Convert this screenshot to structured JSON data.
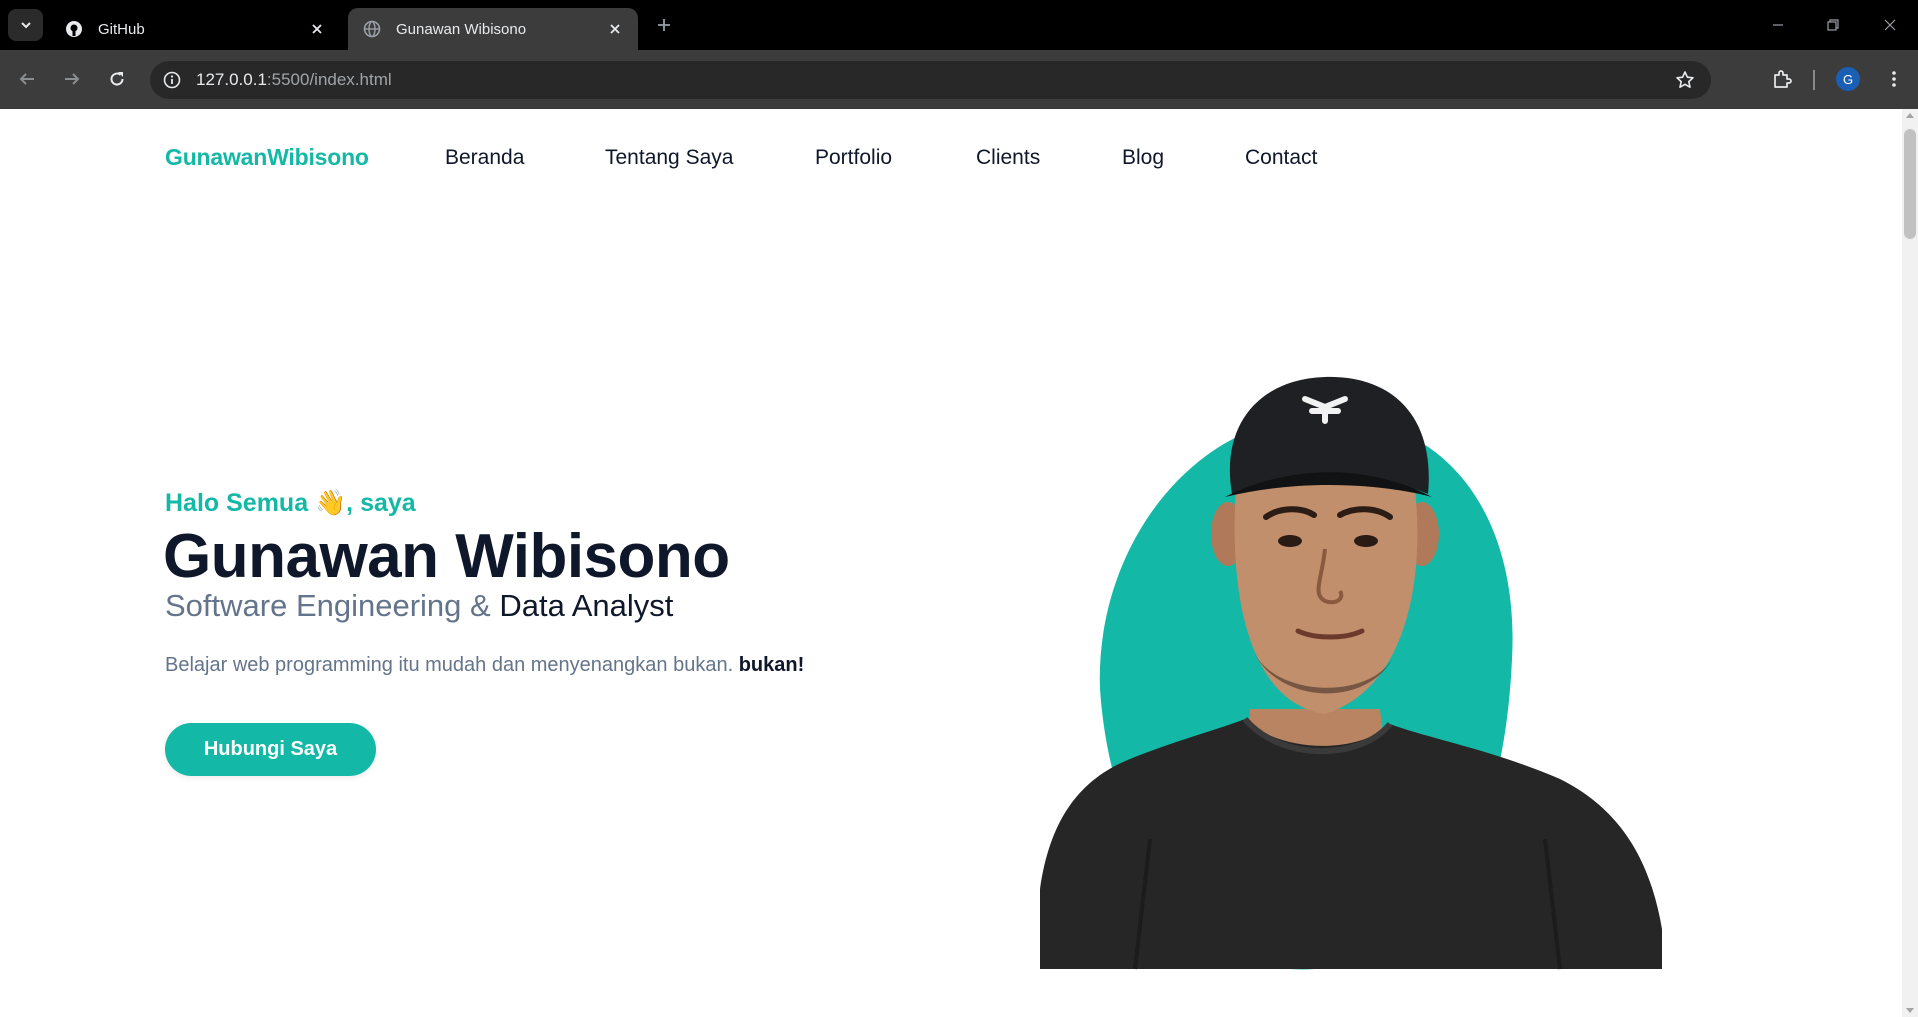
{
  "browser": {
    "tabs": [
      {
        "title": "GitHub",
        "icon": "github-icon",
        "active": false
      },
      {
        "title": "Gunawan Wibisono",
        "icon": "globe-icon",
        "active": true
      }
    ],
    "url_host": "127.0.0.1",
    "url_path": ":5500/index.html",
    "profile_initial": "G"
  },
  "site": {
    "brand": "GunawanWibisono",
    "nav": [
      "Beranda",
      "Tentang Saya",
      "Portfolio",
      "Clients",
      "Blog",
      "Contact"
    ]
  },
  "hero": {
    "greeting": "Halo Semua 👋, saya",
    "name": "Gunawan Wibisono",
    "subtitle_muted": "Software Engineering &",
    "subtitle_strong": "Data Analyst",
    "description": "Belajar web programming itu mudah dan menyenangkan bukan.",
    "description_bold": "bukan!",
    "cta_label": "Hubungi Saya"
  },
  "colors": {
    "accent": "#14b8a6",
    "heading": "#0f172a",
    "muted": "#64748b"
  }
}
